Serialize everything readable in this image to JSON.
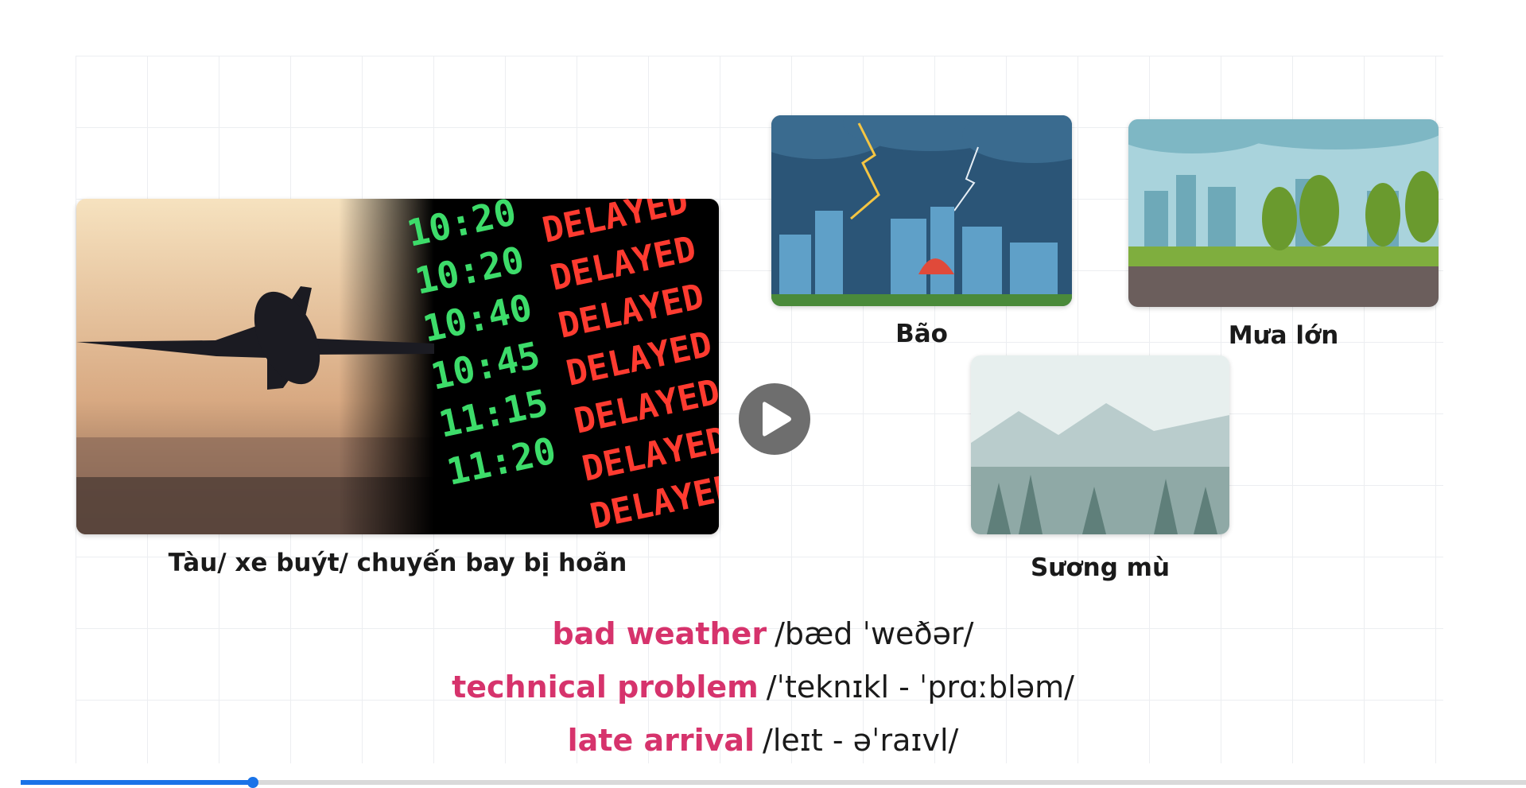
{
  "slide": {
    "images": [
      {
        "id": "delay",
        "caption": "Tàu/ xe buýt/ chuyến bay bị hoãn",
        "board_times": [
          "10:20",
          "10:20",
          "10:40",
          "10:45",
          "11:15",
          "11:20"
        ],
        "board_status": "DELAYED"
      },
      {
        "id": "storm",
        "caption": "Bão"
      },
      {
        "id": "heavy-rain",
        "caption": "Mưa lớn"
      },
      {
        "id": "fog",
        "caption": "Sương mù"
      }
    ],
    "vocabulary": [
      {
        "term": "bad weather",
        "ipa": "/bæd ˈweðər/"
      },
      {
        "term": "technical problem",
        "ipa": "/ˈteknɪkl - ˈprɑːbləm/"
      },
      {
        "term": "late arrival",
        "ipa": "/leɪt - əˈraɪvl/"
      }
    ]
  },
  "player": {
    "progress_fraction": 0.154,
    "accent_color": "#1a73e8",
    "play_icon": "play-icon"
  },
  "colors": {
    "term": "#d6336c",
    "text": "#1a1a1a"
  }
}
